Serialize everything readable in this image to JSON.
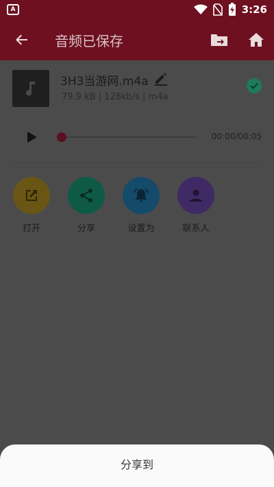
{
  "statusbar": {
    "left_badge": "A",
    "time": "3:26"
  },
  "toolbar": {
    "title": "音频已保存"
  },
  "file": {
    "name": "3H3当游网.m4a",
    "info": "79.9 kB | 128kb/s | m4a"
  },
  "player": {
    "progress_fraction": 0.0,
    "time_label": "00:00/00:05"
  },
  "actions": [
    {
      "label": "打开",
      "color": "#6a5614"
    },
    {
      "label": "分享",
      "color": "#0f5a45"
    },
    {
      "label": "设置为",
      "color": "#144a6a"
    },
    {
      "label": "联系人",
      "color": "#3f2a66"
    }
  ],
  "sheet": {
    "title": "分享到"
  },
  "colors": {
    "toolbar": "#6e1020",
    "scrim_bg": "#4b4b4b",
    "accent_check": "#1e7a5a"
  },
  "icons": {
    "status_left": "text-badge-icon",
    "wifi": "wifi-icon",
    "no_sim": "no-sim-icon",
    "battery": "battery-charging-icon",
    "back": "arrow-back-icon",
    "folder": "folder-move-icon",
    "home": "home-icon",
    "music": "music-note-icon",
    "edit": "pencil-icon",
    "check": "check-circle-icon",
    "play": "play-icon",
    "open": "open-external-icon",
    "share": "share-icon",
    "set_as": "bell-icon",
    "contact": "person-icon"
  }
}
